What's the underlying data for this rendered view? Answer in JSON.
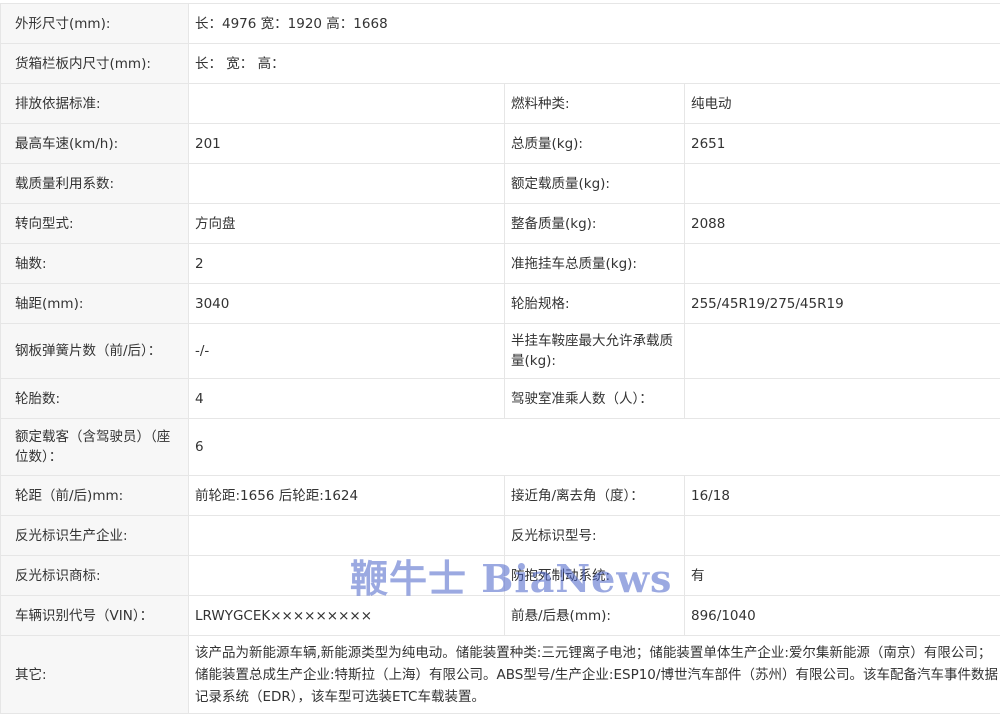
{
  "rows": [
    {
      "l1": "外形尺寸(mm):",
      "v1": "长：4976 宽：1920 高：1668"
    },
    {
      "l1": "货箱栏板内尺寸(mm):",
      "v1": "长： 宽： 高："
    },
    {
      "l1": "排放依据标准:",
      "v1": "",
      "l2": "燃料种类:",
      "v2": "纯电动"
    },
    {
      "l1": "最高车速(km/h):",
      "v1": "201",
      "l2": "总质量(kg):",
      "v2": "2651"
    },
    {
      "l1": "载质量利用系数:",
      "v1": "",
      "l2": "额定载质量(kg):",
      "v2": ""
    },
    {
      "l1": "转向型式:",
      "v1": "方向盘",
      "l2": "整备质量(kg):",
      "v2": "2088"
    },
    {
      "l1": "轴数:",
      "v1": "2",
      "l2": "准拖挂车总质量(kg):",
      "v2": ""
    },
    {
      "l1": "轴距(mm):",
      "v1": "3040",
      "l2": "轮胎规格:",
      "v2": "255/45R19/275/45R19"
    },
    {
      "l1": "钢板弹簧片数（前/后）：",
      "v1": "-/-",
      "l2": "半挂车鞍座最大允许承载质量(kg):",
      "v2": ""
    },
    {
      "l1": "轮胎数:",
      "v1": "4",
      "l2": "驾驶室准乘人数（人）：",
      "v2": ""
    },
    {
      "l1": "额定载客（含驾驶员）（座位数）：",
      "v1": "6"
    },
    {
      "l1": "轮距（前/后)mm:",
      "v1": "前轮距:1656 后轮距:1624",
      "l2": "接近角/离去角（度）：",
      "v2": "16/18"
    },
    {
      "l1": "反光标识生产企业:",
      "v1": "",
      "l2": "反光标识型号:",
      "v2": ""
    },
    {
      "l1": "反光标识商标:",
      "v1": "",
      "l2": "防抱死制动系统:",
      "v2": "有"
    },
    {
      "l1": "车辆识别代号（VIN）：",
      "v1": "LRWYGCEK×××××××××",
      "l2": "前悬/后悬(mm):",
      "v2": "896/1040"
    },
    {
      "l1": "其它:",
      "v1": "该产品为新能源车辆,新能源类型为纯电动。储能装置种类:三元锂离子电池；储能装置单体生产企业:爱尔集新能源（南京）有限公司；储能装置总成生产企业:特斯拉（上海）有限公司。ABS型号/生产企业:ESP10/博世汽车部件（苏州）有限公司。该车配备汽车事件数据记录系统（EDR），该车型可选装ETC车载装置。"
    }
  ],
  "watermark": "鞭牛士 BiaNews",
  "colors": {
    "label_bg": "#f7f7f7",
    "border": "#e6e6e6",
    "text": "#333333",
    "watermark": "#4a63c9"
  }
}
